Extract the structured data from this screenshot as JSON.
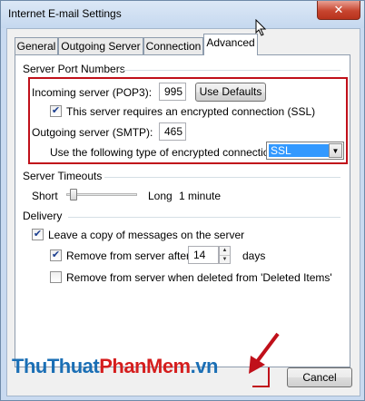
{
  "window": {
    "title": "Internet E-mail Settings",
    "close_glyph": "✕"
  },
  "tabs": [
    {
      "label": "General",
      "active": false
    },
    {
      "label": "Outgoing Server",
      "active": false
    },
    {
      "label": "Connection",
      "active": false
    },
    {
      "label": "Advanced",
      "active": true
    }
  ],
  "server_ports": {
    "group_label": "Server Port Numbers",
    "incoming_label": "Incoming server (POP3):",
    "incoming_value": "995",
    "use_defaults_label": "Use Defaults",
    "ssl_required_label": "This server requires an encrypted connection (SSL)",
    "ssl_required_checked": true,
    "outgoing_label": "Outgoing server (SMTP):",
    "outgoing_value": "465",
    "encryption_label": "Use the following type of encrypted connection:",
    "encryption_value": "SSL"
  },
  "timeouts": {
    "group_label": "Server Timeouts",
    "short_label": "Short",
    "long_label": "Long",
    "value_label": "1 minute",
    "slider_fraction": 0.05
  },
  "delivery": {
    "group_label": "Delivery",
    "leave_copy_label": "Leave a copy of messages on the server",
    "leave_copy_checked": true,
    "remove_after_label": "Remove from server after",
    "remove_after_checked": true,
    "remove_after_value": "14",
    "days_label": "days",
    "remove_deleted_label": "Remove from server when deleted from 'Deleted Items'",
    "remove_deleted_checked": false
  },
  "footer": {
    "cancel_label": "Cancel"
  },
  "watermark": {
    "part1": "ThuThuat",
    "part2": "PhanMem",
    "part3": ".vn"
  },
  "colors": {
    "annotation_red": "#c0101a",
    "selection_blue": "#3399ff"
  }
}
